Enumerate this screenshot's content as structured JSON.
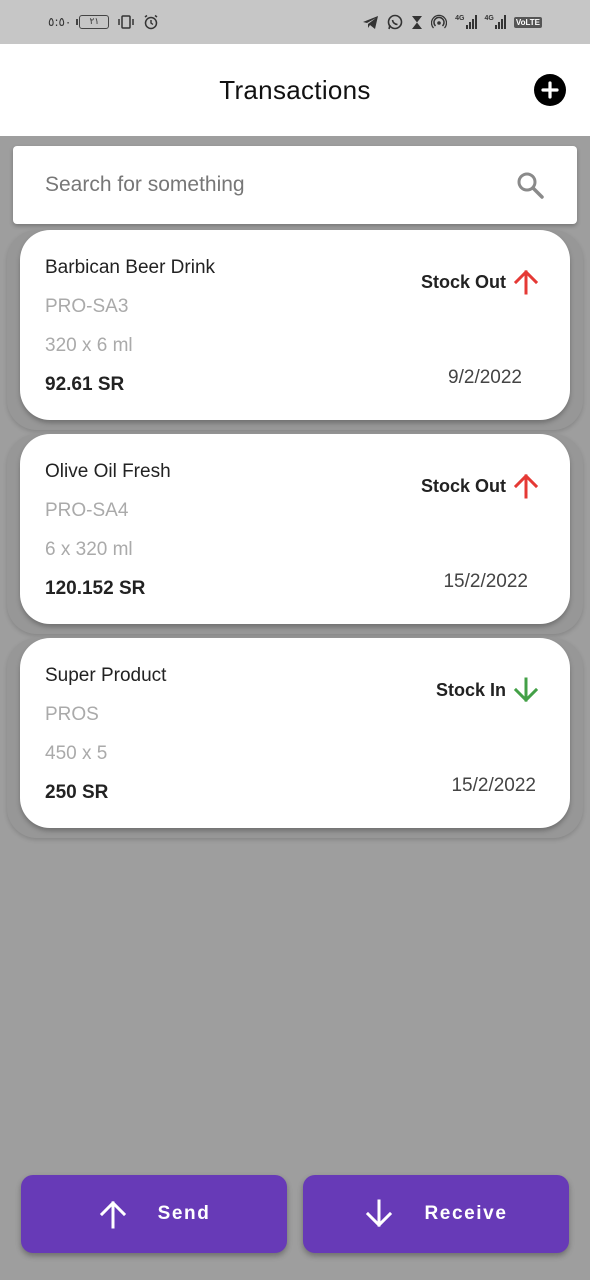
{
  "status_bar": {
    "time": "٥:٥٠",
    "battery": "٢١",
    "network_1": "4G",
    "network_2": "4G",
    "volte": "VoLTE"
  },
  "header": {
    "title": "Transactions",
    "add_icon": "plus-circle-icon"
  },
  "search": {
    "placeholder": "Search for something",
    "value": "",
    "icon": "search-icon"
  },
  "transactions": [
    {
      "name": "Barbican Beer Drink",
      "code": "PRO-SA3",
      "quantity": "320 x 6 ml",
      "price": "92.61 SR",
      "status": "Stock Out",
      "direction": "out",
      "date": "9/2/2022"
    },
    {
      "name": "Olive Oil Fresh",
      "code": "PRO-SA4",
      "quantity": "6 x 320 ml",
      "price": "120.152 SR",
      "status": "Stock Out",
      "direction": "out",
      "date": "15/2/2022"
    },
    {
      "name": "Super Product",
      "code": "PROS",
      "quantity": "450 x 5",
      "price": "250 SR",
      "status": "Stock In",
      "direction": "in",
      "date": "15/2/2022"
    }
  ],
  "actions": {
    "send_label": "Send",
    "receive_label": "Receive"
  },
  "colors": {
    "accent": "#673ab7",
    "stock_out": "#e53935",
    "stock_in": "#43a047",
    "background": "#9e9e9e"
  }
}
